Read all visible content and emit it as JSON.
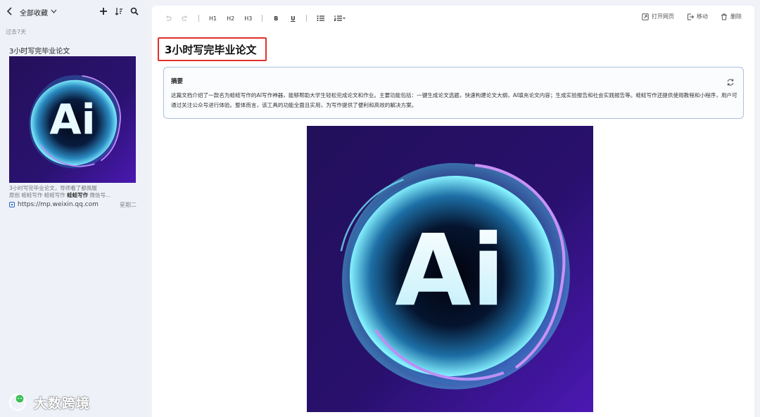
{
  "sidebar": {
    "folder_label": "全部收藏",
    "section_label": "过去7天",
    "card": {
      "title": "3小时写完毕业论文",
      "desc_line1": "3小时写完毕业论文，导师看了都佩服",
      "desc_line2_prefix": "原创 蛙蛙写作 蛙蛙写作 ",
      "desc_line2_bold": "蛙蛙写作",
      "desc_line2_suffix": " 微信号...",
      "url": "https://mp.weixin.qq.com",
      "date": "星期二"
    }
  },
  "toolbar": {
    "h1": "H1",
    "h2": "H2",
    "h3": "H3",
    "bold": "B",
    "underline": "U",
    "open_page": "打开网页",
    "move": "移动",
    "delete": "删除"
  },
  "document": {
    "title": "3小时写完毕业论文",
    "summary_label": "摘要",
    "summary_text": "这篇文档介绍了一款名为蛙蛙写作的AI写作神器，能够帮助大学生轻松完成论文和作业。主要功能包括：一键生成论文选题，快速构建论文大纲，AI填充论文内容；生成实验报告和社会实践报告等。蛙蛙写作还提供使用教程和小程序，用户可通过关注公众号进行体验。整体而言，该工具的功能全面且实用，为写作提供了便利和高效的解决方案。",
    "image_text": "Ai"
  },
  "watermark": {
    "text": "大数跨境"
  },
  "colors": {
    "highlight_border": "#e0312a",
    "summary_border": "#aac0de",
    "image_bg": "#2a0f6e",
    "glow": "#5fe0f5"
  }
}
